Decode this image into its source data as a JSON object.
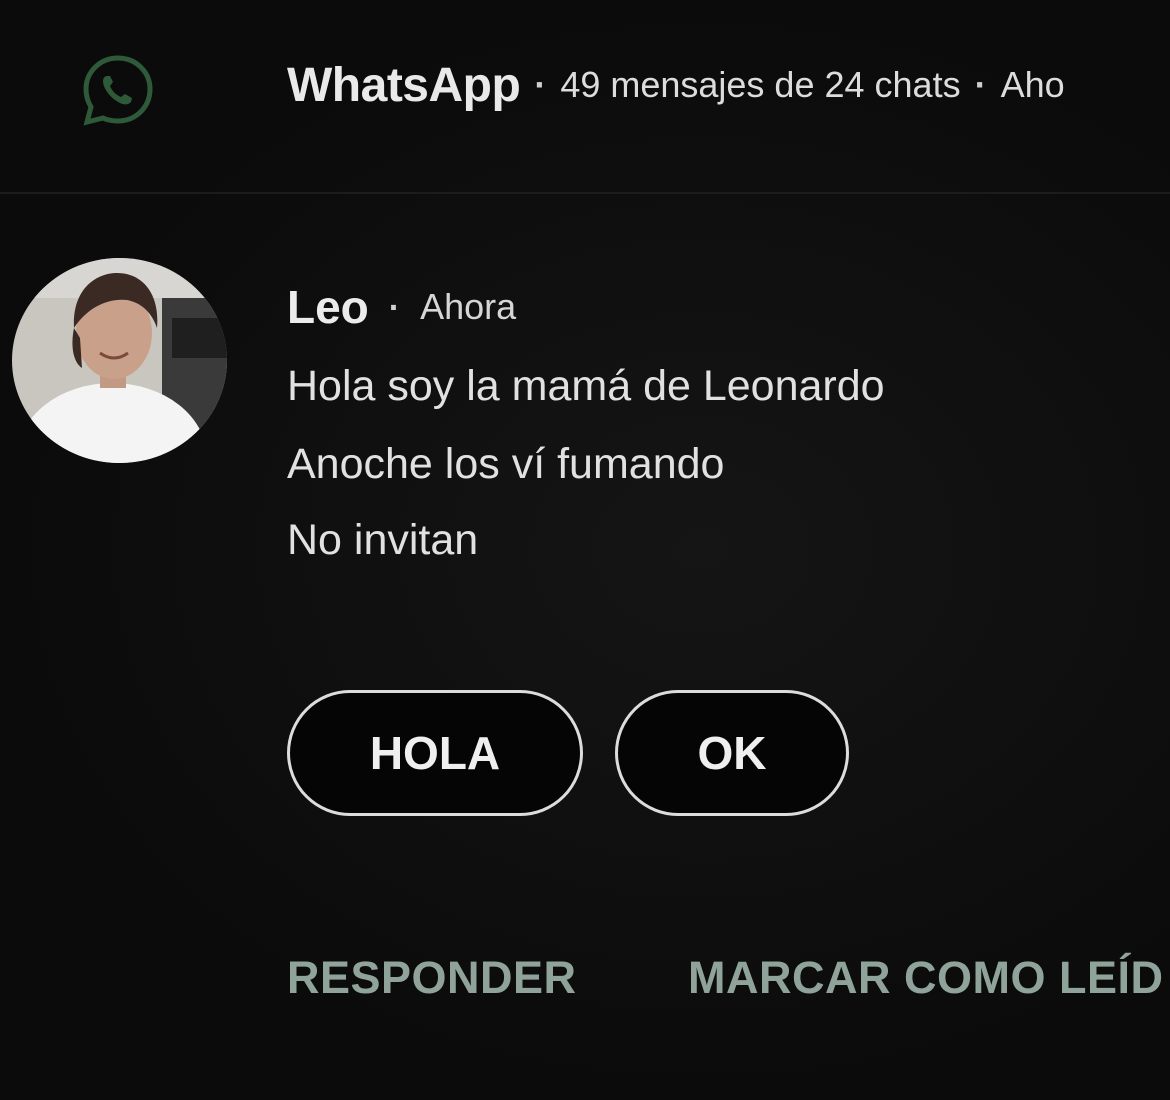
{
  "header": {
    "app_name": "WhatsApp",
    "summary": "49 mensajes de 24 chats",
    "time": "Aho",
    "separator": "·",
    "icon": "whatsapp-icon"
  },
  "message": {
    "sender": "Leo",
    "separator": "·",
    "time": "Ahora",
    "lines": [
      "Hola soy la mamá de Leonardo",
      "Anoche los ví fumando",
      "No invitan"
    ],
    "avatar": "avatar-photo"
  },
  "quick_replies": [
    "HOLA",
    "OK"
  ],
  "actions": {
    "reply": "RESPONDER",
    "mark_read": "MARCAR COMO LEÍD"
  },
  "colors": {
    "background": "#0b0b0b",
    "text": "#e1e1e1",
    "action_text": "#8fa39a",
    "icon_green": "#2f5a3a"
  }
}
